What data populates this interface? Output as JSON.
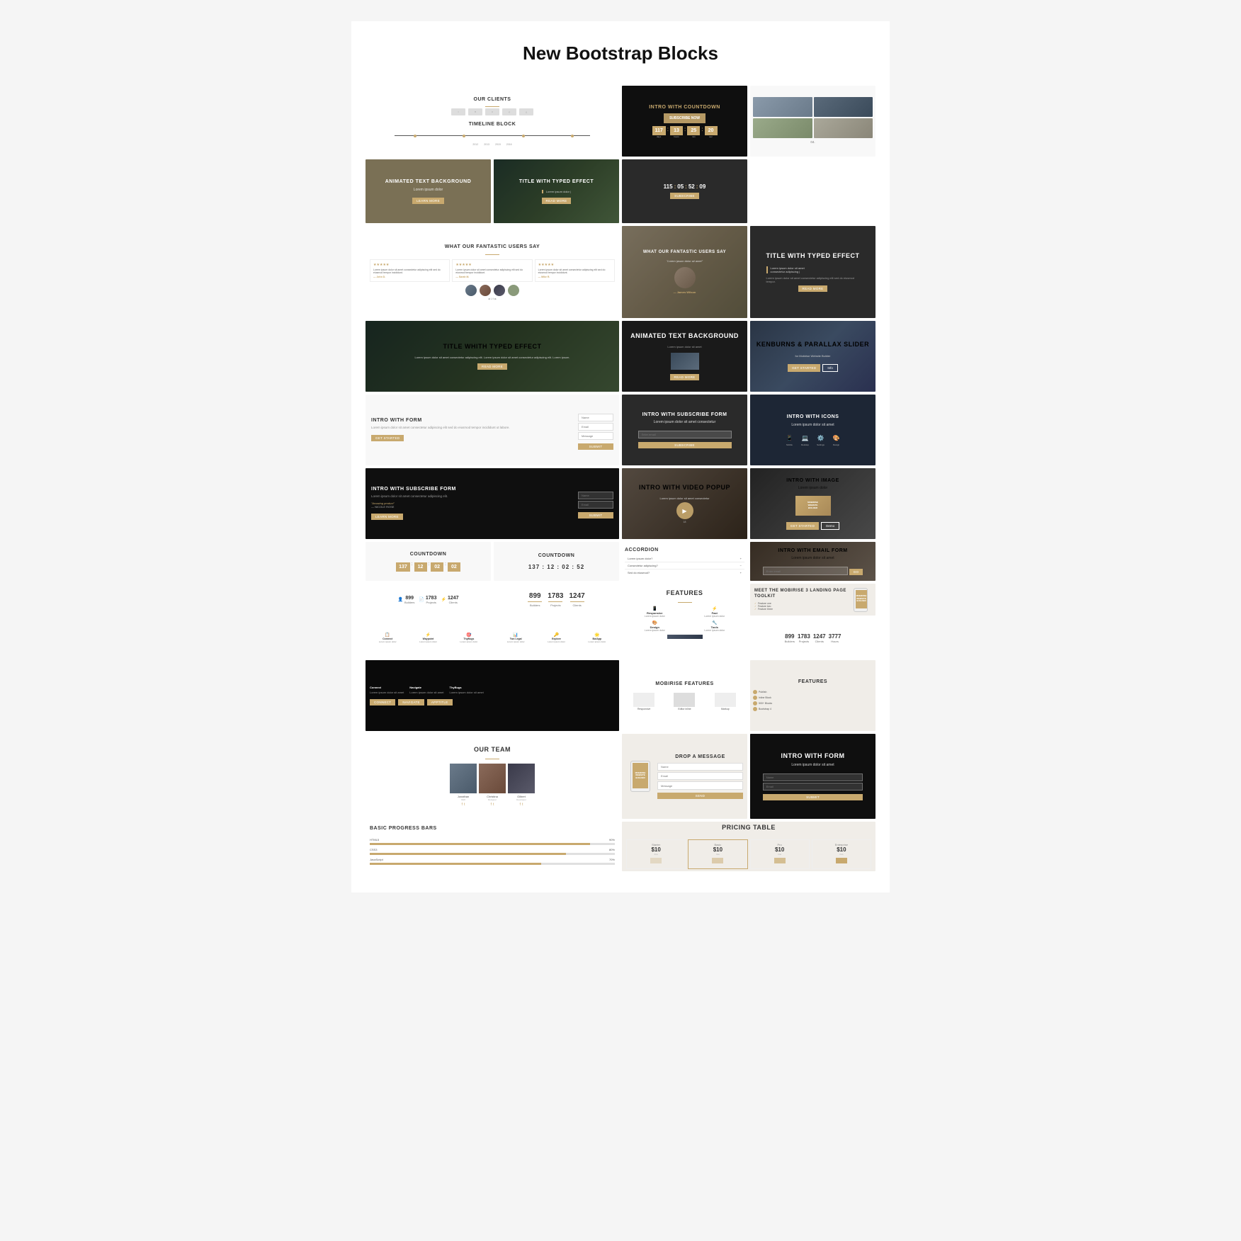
{
  "page": {
    "title": "New Bootstrap Blocks"
  },
  "blocks": {
    "our_clients": "OUR CLIENTS",
    "timeline_block": "TIMELINE BLOCK",
    "animated_text_bg": "ANIMATED TEXT BACKGROUND",
    "what_users_say": "WHAT OUR FANTASTIC USERS SAY",
    "intro_countdown": "INTRO WITH COUNTDOWN",
    "subscribe_now": "SUBSCRIBE NOW",
    "title_typed_effect": "TITLE WITH TYPED EFFECT",
    "title_typed_effect2": "TITLE WITH TYPED EFFECT",
    "title_with_typed_full": "TITLE WHITH TYPED EFFECT",
    "kenburns": "KENBURNS & PARALLAX SLIDER",
    "animated_text_bg2": "ANIMATED TEXT BACKGROUND",
    "intro_with_form": "INTRO WITH FORM",
    "intro_subscribe": "INTRO WITH SUBSCRIBE FORM",
    "intro_icons": "INTRO WITH ICONS",
    "intro_image": "INTRO WITH IMAGE",
    "intro_email": "INTRO WITH EMAIL FORM",
    "intro_video": "INTRO WITH VIDEO POPUP",
    "countdown1_title": "COUNTDOWN",
    "countdown1_vals": [
      "137",
      "12",
      "02",
      "02"
    ],
    "countdown2_title": "COUNTDOWN",
    "countdown2_vals": [
      "137",
      "12",
      "02",
      "52"
    ],
    "countdown3_vals": [
      "115",
      "05",
      "52",
      "09"
    ],
    "stats1": [
      {
        "n": "899",
        "l": "Builders"
      },
      {
        "n": "1783",
        "l": "Projects"
      },
      {
        "n": "1247",
        "l": "Clients"
      },
      {
        "n": "3777",
        "l": "Hours"
      }
    ],
    "stats2": [
      {
        "n": "899",
        "l": "Builders"
      },
      {
        "n": "1783",
        "l": "Projects"
      },
      {
        "n": "1247",
        "l": "Clients"
      }
    ],
    "stats3": [
      {
        "n": "899",
        "l": "Builders"
      },
      {
        "n": "1783",
        "l": "Projects"
      },
      {
        "n": "1247",
        "l": "Clients"
      }
    ],
    "meet_mobirise": "MEET THE MOBIRISE 3 LANDING PAGE TOOLKIT",
    "features": "FEATURES",
    "mobirise_features": "MOBIRISE FEATURES",
    "our_team": "OUR TEAM",
    "drop_message": "DROP A MESSAGE",
    "intro_form2": "INTRO WITH FORM",
    "basic_progress": "Basic Progress Bars",
    "pricing_table": "PRICING TABLE",
    "accordion": "Accordion",
    "prices": [
      "$10",
      "$10",
      "$10",
      "$10"
    ],
    "countdown_vals_large": [
      "117",
      "13",
      "25",
      "20"
    ],
    "team_members": [
      {
        "name": "Jonathan"
      },
      {
        "name": "Christina"
      },
      {
        "name": "Gilbert Team"
      }
    ]
  }
}
